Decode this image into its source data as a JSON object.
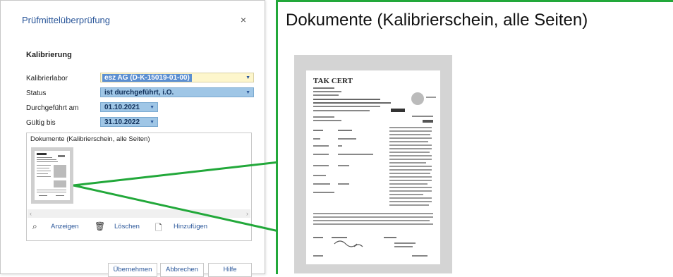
{
  "dialog": {
    "title": "Prüfmittelüberprüfung",
    "close_glyph": "×",
    "section": "Kalibrierung",
    "fields": {
      "kalibrierlabor": {
        "label": "Kalibrierlabor",
        "value": "esz AG (D-K-15019-01-00)"
      },
      "status": {
        "label": "Status",
        "value": "ist durchgeführt, i.O."
      },
      "durchgefuehrt": {
        "label": "Durchgeführt am",
        "value": "01.10.2021"
      },
      "gueltig": {
        "label": "Gültig bis",
        "value": "31.10.2022"
      }
    },
    "documents": {
      "title": "Dokumente (Kalibrierschein, alle Seiten)",
      "actions": {
        "view": "Anzeigen",
        "delete": "Löschen",
        "add": "Hinzufügen"
      }
    },
    "footer": {
      "apply": "Übernehmen",
      "cancel": "Abbrechen",
      "help": "Hilfe"
    }
  },
  "zoom": {
    "title": "Dokumente (Kalibrierschein, alle Seiten)",
    "doc_logo": "TAK CERT"
  },
  "colors": {
    "accent_green": "#22a83a",
    "link_blue": "#2b579a",
    "field_blue": "#9fc6e6",
    "field_yellow": "#fdf6cc"
  },
  "icons": [
    "close-icon",
    "dropdown-arrow-icon",
    "search-icon",
    "trash-icon",
    "add-document-icon"
  ]
}
